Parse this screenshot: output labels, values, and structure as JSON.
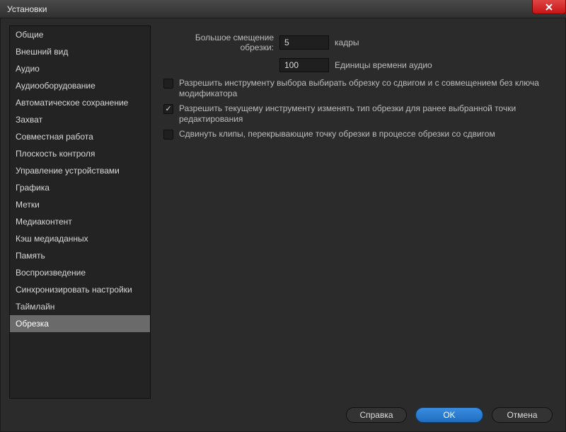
{
  "titlebar": {
    "title": "Установки"
  },
  "sidebar": {
    "items": [
      {
        "label": "Общие"
      },
      {
        "label": "Внешний вид"
      },
      {
        "label": "Аудио"
      },
      {
        "label": "Аудиооборудование"
      },
      {
        "label": "Автоматическое сохранение"
      },
      {
        "label": "Захват"
      },
      {
        "label": "Совместная работа"
      },
      {
        "label": "Плоскость контроля"
      },
      {
        "label": "Управление устройствами"
      },
      {
        "label": "Графика"
      },
      {
        "label": "Метки"
      },
      {
        "label": "Медиаконтент"
      },
      {
        "label": "Кэш медиаданных"
      },
      {
        "label": "Память"
      },
      {
        "label": "Воспроизведение"
      },
      {
        "label": "Синхронизировать настройки"
      },
      {
        "label": "Таймлайн"
      },
      {
        "label": "Обрезка"
      }
    ],
    "selected_index": 17
  },
  "main": {
    "large_offset": {
      "label": "Большое смещение обрезки:",
      "value": "5",
      "unit": "кадры"
    },
    "audio_units": {
      "value": "100",
      "unit": "Единицы времени аудио"
    },
    "checkboxes": [
      {
        "checked": false,
        "label": "Разрешить инструменту выбора выбирать обрезку со сдвигом и с совмещением без ключа модификатора"
      },
      {
        "checked": true,
        "label": "Разрешить текущему инструменту изменять тип обрезки для ранее выбранной точки редактирования"
      },
      {
        "checked": false,
        "label": "Сдвинуть клипы, перекрывающие точку обрезки в процессе обрезки со сдвигом"
      }
    ]
  },
  "buttons": {
    "help": "Справка",
    "ok": "OK",
    "cancel": "Отмена"
  }
}
